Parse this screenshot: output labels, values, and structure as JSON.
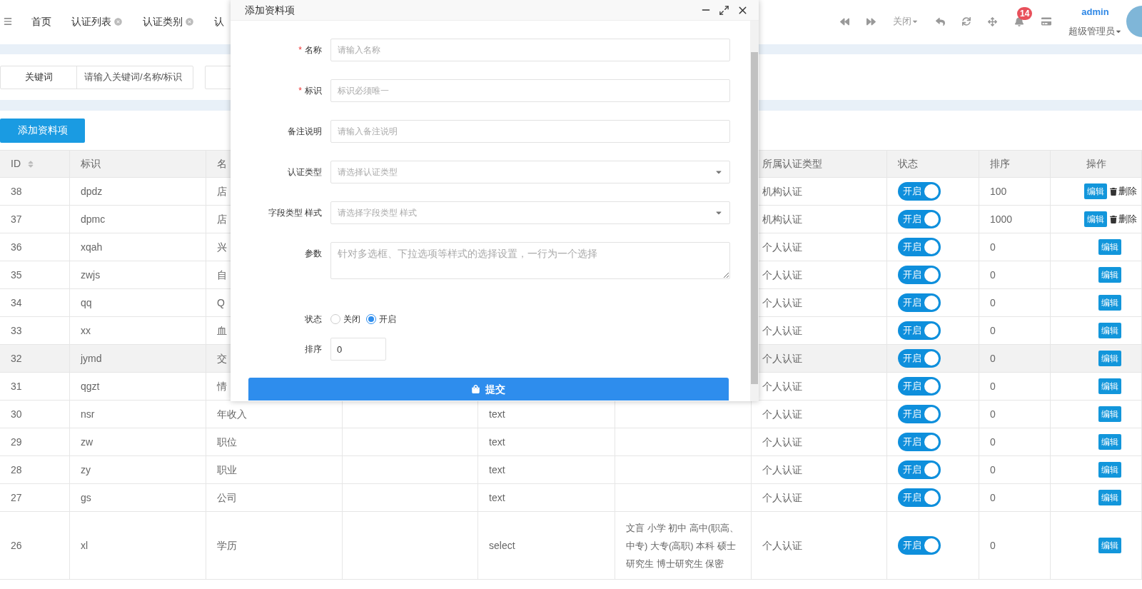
{
  "topbar": {
    "tabs": [
      {
        "label": "首页",
        "closable": false
      },
      {
        "label": "认证列表",
        "closable": true
      },
      {
        "label": "认证类别",
        "closable": true
      },
      {
        "label": "认",
        "closable": false
      }
    ],
    "close_menu": "关闭",
    "notifications": "14",
    "user": {
      "name": "admin",
      "role": "超级管理员"
    }
  },
  "filter": {
    "label": "关键词",
    "placeholder": "请输入关键词/名称/标识"
  },
  "add_button": "添加资料项",
  "table": {
    "columns": [
      {
        "label": "ID",
        "sortable": true
      },
      {
        "label": "标识"
      },
      {
        "label": "名"
      },
      {
        "label": "所属认证类型"
      },
      {
        "label": "状态"
      },
      {
        "label": "排序"
      },
      {
        "label": "操作"
      }
    ],
    "rows": [
      {
        "id": "38",
        "key": "dpdz",
        "name": "店",
        "cert_type": "机构认证",
        "status": {
          "label": "开启",
          "on": true
        },
        "sort": "100",
        "actions": [
          {
            "kind": "edit",
            "label": "编辑"
          },
          {
            "kind": "delete",
            "label": "删除"
          }
        ],
        "selected": false
      },
      {
        "id": "37",
        "key": "dpmc",
        "name": "店",
        "cert_type": "机构认证",
        "status": {
          "label": "开启",
          "on": true
        },
        "sort": "1000",
        "actions": [
          {
            "kind": "edit",
            "label": "编辑"
          },
          {
            "kind": "delete",
            "label": "删除"
          }
        ],
        "selected": false
      },
      {
        "id": "36",
        "key": "xqah",
        "name": "兴",
        "cert_type": "个人认证",
        "status": {
          "label": "开启",
          "on": true
        },
        "sort": "0",
        "actions": [
          {
            "kind": "edit",
            "label": "编辑"
          }
        ],
        "selected": false
      },
      {
        "id": "35",
        "key": "zwjs",
        "name": "自",
        "cert_type": "个人认证",
        "status": {
          "label": "开启",
          "on": true
        },
        "sort": "0",
        "actions": [
          {
            "kind": "edit",
            "label": "编辑"
          }
        ],
        "selected": false
      },
      {
        "id": "34",
        "key": "qq",
        "name": "Q",
        "cert_type": "个人认证",
        "status": {
          "label": "开启",
          "on": true
        },
        "sort": "0",
        "actions": [
          {
            "kind": "edit",
            "label": "编辑"
          }
        ],
        "selected": false
      },
      {
        "id": "33",
        "key": "xx",
        "name": "血",
        "cert_type": "个人认证",
        "status": {
          "label": "开启",
          "on": true
        },
        "sort": "0",
        "actions": [
          {
            "kind": "edit",
            "label": "编辑"
          }
        ],
        "selected": false
      },
      {
        "id": "32",
        "key": "jymd",
        "name": "交",
        "cert_type": "个人认证",
        "status": {
          "label": "开启",
          "on": true
        },
        "sort": "0",
        "actions": [
          {
            "kind": "edit",
            "label": "编辑"
          }
        ],
        "selected": true
      },
      {
        "id": "31",
        "key": "qgzt",
        "name": "情",
        "cert_type": "个人认证",
        "status": {
          "label": "开启",
          "on": true
        },
        "sort": "0",
        "actions": [
          {
            "kind": "edit",
            "label": "编辑"
          }
        ],
        "selected": false
      },
      {
        "id": "30",
        "key": "nsr",
        "name": "年收入",
        "type": "text",
        "cert_type": "个人认证",
        "status": {
          "label": "开启",
          "on": true
        },
        "sort": "0",
        "actions": [
          {
            "kind": "edit",
            "label": "编辑"
          }
        ],
        "selected": false
      },
      {
        "id": "29",
        "key": "zw",
        "name": "职位",
        "type": "text",
        "cert_type": "个人认证",
        "status": {
          "label": "开启",
          "on": true
        },
        "sort": "0",
        "actions": [
          {
            "kind": "edit",
            "label": "编辑"
          }
        ],
        "selected": false
      },
      {
        "id": "28",
        "key": "zy",
        "name": "职业",
        "type": "text",
        "cert_type": "个人认证",
        "status": {
          "label": "开启",
          "on": true
        },
        "sort": "0",
        "actions": [
          {
            "kind": "edit",
            "label": "编辑"
          }
        ],
        "selected": false
      },
      {
        "id": "27",
        "key": "gs",
        "name": "公司",
        "type": "text",
        "cert_type": "个人认证",
        "status": {
          "label": "开启",
          "on": true
        },
        "sort": "0",
        "actions": [
          {
            "kind": "edit",
            "label": "编辑"
          }
        ],
        "selected": false
      },
      {
        "id": "26",
        "key": "xl",
        "name": "学历",
        "type": "select",
        "options": "文盲 小学 初中 高中(职高、中专) 大专(高职) 本科 硕士研究生 博士研究生 保密",
        "cert_type": "个人认证",
        "status": {
          "label": "开启",
          "on": true
        },
        "sort": "0",
        "actions": [
          {
            "kind": "edit",
            "label": "编辑"
          }
        ],
        "selected": false
      }
    ]
  },
  "modal": {
    "title": "添加资料项",
    "fields": [
      {
        "kind": "text",
        "label": "名称",
        "required_mark": "*",
        "placeholder": "请输入名称"
      },
      {
        "kind": "text",
        "label": "标识",
        "required_mark": "*",
        "placeholder": "标识必须唯一"
      },
      {
        "kind": "text",
        "label": "备注说明",
        "placeholder": "请输入备注说明"
      },
      {
        "kind": "select",
        "label": "认证类型",
        "placeholder": "请选择认证类型"
      },
      {
        "kind": "select",
        "label": "字段类型 样式",
        "placeholder": "请选择字段类型 样式"
      },
      {
        "kind": "textarea",
        "label": "参数",
        "placeholder": "针对多选框、下拉选项等样式的选择设置，一行为一个选择"
      },
      {
        "kind": "radio",
        "label": "状态",
        "options": [
          {
            "label": "关闭",
            "selected": false
          },
          {
            "label": "开启",
            "selected": true
          }
        ]
      },
      {
        "kind": "number",
        "label": "排序",
        "value": "0"
      }
    ],
    "submit": "提交"
  }
}
